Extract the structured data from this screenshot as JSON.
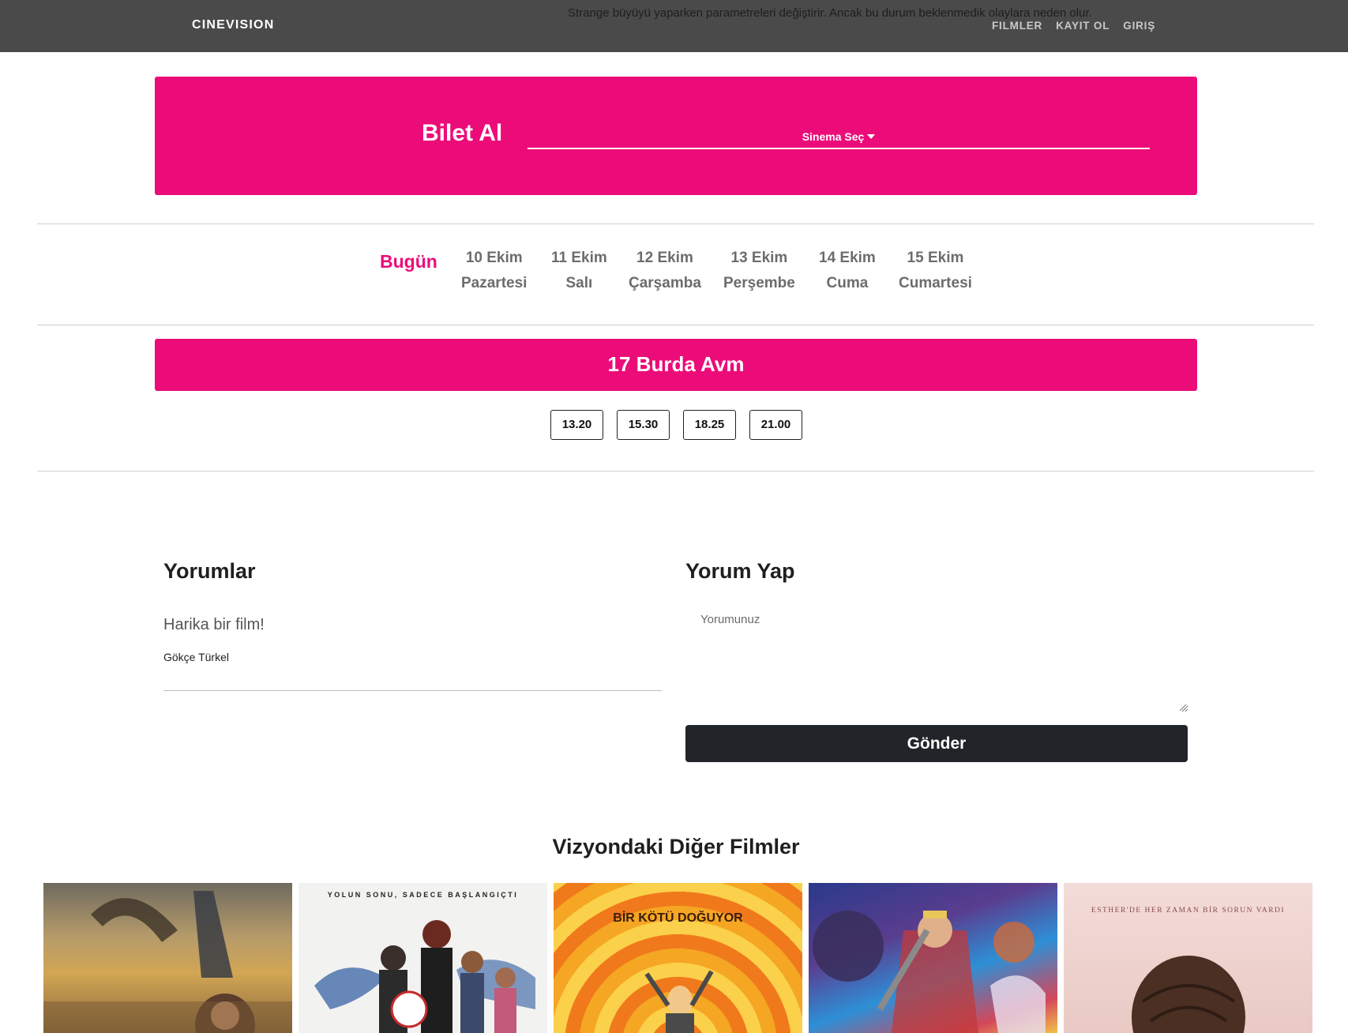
{
  "navbar": {
    "brand": "CINEVISION",
    "overflow_line_1": "",
    "overflow_line_2": "Strange büyüyü yaparken parametreleri değiştirir. Ancak bu durum beklenmedik olaylara neden olur.",
    "links": [
      "FILMLER",
      "KAYIT OL",
      "GIRIŞ"
    ]
  },
  "ticket": {
    "title": "Bilet Al",
    "cinema_select_label": "Sinema Seç"
  },
  "dates": {
    "today": "Bugün",
    "tabs": [
      {
        "day": "10 Ekim",
        "weekday": "Pazartesi"
      },
      {
        "day": "11 Ekim",
        "weekday": "Salı"
      },
      {
        "day": "12 Ekim",
        "weekday": "Çarşamba"
      },
      {
        "day": "13 Ekim",
        "weekday": "Perşembe"
      },
      {
        "day": "14 Ekim",
        "weekday": "Cuma"
      },
      {
        "day": "15 Ekim",
        "weekday": "Cumartesi"
      }
    ]
  },
  "cinema": {
    "name": "17 Burda Avm",
    "showtimes": [
      "13.20",
      "15.30",
      "18.25",
      "21.00"
    ]
  },
  "comments": {
    "title": "Yorumlar",
    "items": [
      {
        "text": "Harika bir film!",
        "author": "Gökçe Türkel"
      }
    ]
  },
  "comment_form": {
    "title": "Yorum Yap",
    "placeholder": "Yorumunuz",
    "submit_label": "Gönder"
  },
  "other_films": {
    "title": "Vizyondaki Diğer Filmler",
    "posters": [
      {
        "tagline": ""
      },
      {
        "tagline": "YOLUN SONU, SADECE BAŞLANGIÇTI"
      },
      {
        "tagline": "BİR KÖTÜ DOĞUYOR"
      },
      {
        "tagline": ""
      },
      {
        "tagline": "ESTHER'DE HER ZAMAN BİR SORUN VARDI"
      }
    ]
  },
  "colors": {
    "accent": "#ec0c79",
    "navbar": "#4a4a4a",
    "button_dark": "#212529"
  }
}
